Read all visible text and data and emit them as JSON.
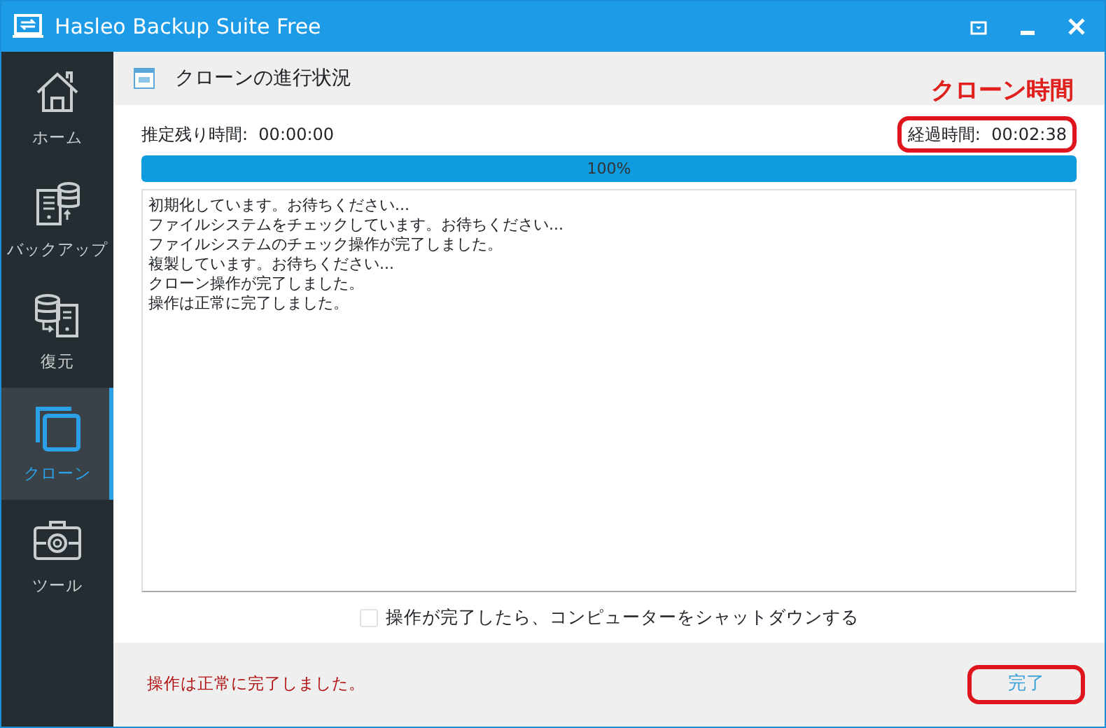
{
  "window": {
    "title": "Hasleo Backup Suite Free"
  },
  "sidebar": {
    "items": [
      {
        "kind": "home",
        "label": "ホーム",
        "selected": false
      },
      {
        "kind": "backup",
        "label": "バックアップ",
        "selected": false
      },
      {
        "kind": "restore",
        "label": "復元",
        "selected": false
      },
      {
        "kind": "clone",
        "label": "クローン",
        "selected": true
      },
      {
        "kind": "tools",
        "label": "ツール",
        "selected": false
      }
    ]
  },
  "header": {
    "title": "クローンの進行状況"
  },
  "annotation": {
    "label": "クローン時間"
  },
  "remaining": {
    "label": "推定残り時間:",
    "value": "00:00:00"
  },
  "elapsed": {
    "label": "経過時間:",
    "value": "00:02:38",
    "highlighted": true
  },
  "progress": {
    "level": 1.0,
    "reading": "100%"
  },
  "log": [
    "初期化しています。お待ちください...",
    "ファイルシステムをチェックしています。お待ちください...",
    "ファイルシステムのチェック操作が完了しました。",
    "複製しています。お待ちください...",
    "クローン操作が完了しました。",
    "操作は正常に完了しました。"
  ],
  "shutdown_option": {
    "label": "操作が完了したら、コンピューターをシャットダウンする",
    "checked": false
  },
  "status": "操作は正常に完了しました。",
  "done_button": {
    "label": "完了",
    "highlighted": true
  }
}
